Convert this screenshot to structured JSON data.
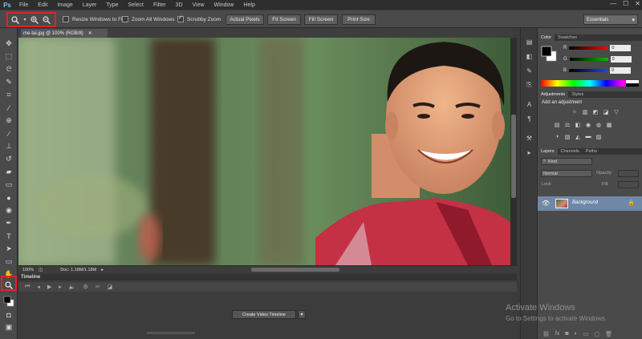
{
  "menubar": {
    "logo": "Ps",
    "items": [
      "File",
      "Edit",
      "Image",
      "Layer",
      "Type",
      "Select",
      "Filter",
      "3D",
      "View",
      "Window",
      "Help"
    ],
    "window_controls": [
      "—",
      "☐",
      "✕"
    ]
  },
  "options": {
    "resize_windows_to_fit": {
      "label": "Resize Windows to Fit",
      "checked": false
    },
    "zoom_all_windows": {
      "label": "Zoom All Windows",
      "checked": false
    },
    "scrubby_zoom": {
      "label": "Scrubby Zoom",
      "checked": true
    },
    "buttons": {
      "actual_pixels": "Actual Pixels",
      "fit_screen": "Fit Screen",
      "fill_screen": "Fill Screen",
      "print_size": "Print Size"
    },
    "workspace": "Essentials"
  },
  "document": {
    "tab_title": "me-tai.jpg @ 100% (RGB/8)",
    "zoom_level": "100%",
    "doc_size": "Doc: 1.18M/1.18M"
  },
  "timeline": {
    "title": "Timeline",
    "create_button": "Create Video Timeline"
  },
  "panels": {
    "color_tabs": [
      "Color",
      "Swatches"
    ],
    "color_channels": [
      {
        "label": "R",
        "value": "0"
      },
      {
        "label": "G",
        "value": "0"
      },
      {
        "label": "B",
        "value": "0"
      }
    ],
    "adjustment_tabs": [
      "Adjustments",
      "Styles"
    ],
    "add_adjustment": "Add an adjustment",
    "layer_tabs": [
      "Layers",
      "Channels",
      "Paths"
    ],
    "kind": "Kind",
    "blend_mode": "Normal",
    "opacity_label": "Opacity:",
    "lock_label": "Lock:",
    "fill_label": "Fill:",
    "layer_name": "Background"
  },
  "watermark": {
    "line1": "Activate Windows",
    "line2": "Go to Settings to activate Windows."
  },
  "colors": {
    "highlight": "#e52222",
    "accent": "#7cc3f2",
    "layer_selected": "#7187a8"
  }
}
